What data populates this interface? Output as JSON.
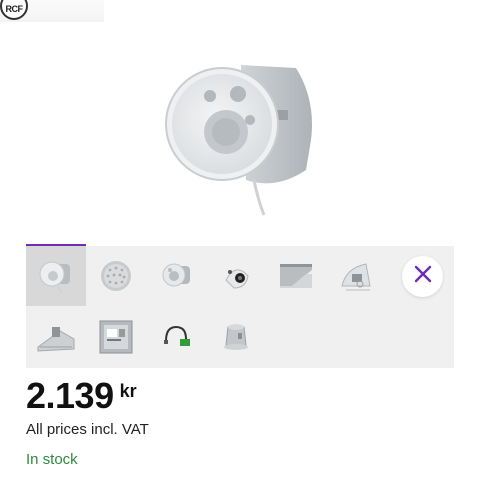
{
  "brand": {
    "logo_text": "RCF"
  },
  "product": {
    "price": "2.139",
    "currency": "kr",
    "vat_note": "All prices incl. VAT",
    "stock_status": "In stock"
  },
  "gallery": {
    "selected_index": 0,
    "thumbnails": [
      {
        "name": "thumb-speaker-front"
      },
      {
        "name": "thumb-grille"
      },
      {
        "name": "thumb-speaker-angle"
      },
      {
        "name": "thumb-speaker-top"
      },
      {
        "name": "thumb-mounting-bracket"
      },
      {
        "name": "thumb-speaker-back"
      },
      {
        "name": "thumb-clamp"
      },
      {
        "name": "thumb-label"
      },
      {
        "name": "thumb-connector"
      },
      {
        "name": "thumb-can"
      }
    ]
  },
  "colors": {
    "accent": "#6f2bb4",
    "in_stock": "#2e8b3d"
  },
  "icons": {
    "close": "close-icon"
  }
}
